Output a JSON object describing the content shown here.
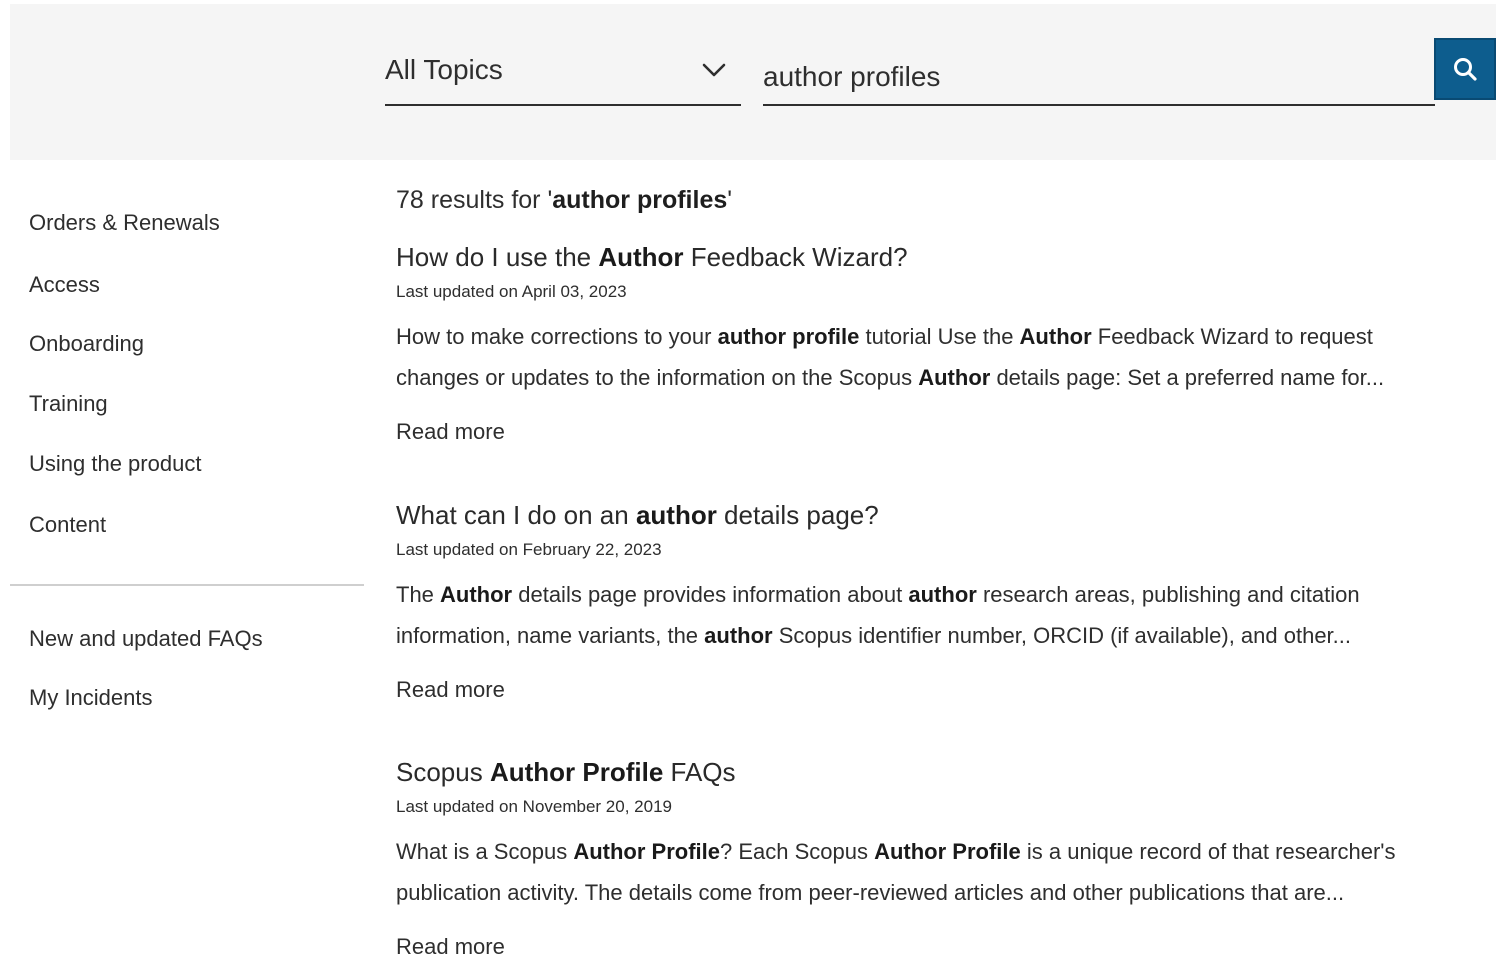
{
  "search": {
    "topic_selected": "All Topics",
    "query_value": "author profiles"
  },
  "sidebar": {
    "primary_items": [
      {
        "label": "Orders & Renewals"
      },
      {
        "label": "Access"
      },
      {
        "label": "Onboarding"
      },
      {
        "label": "Training"
      },
      {
        "label": "Using the product"
      },
      {
        "label": "Content"
      }
    ],
    "secondary_items": [
      {
        "label": "New and updated FAQs"
      },
      {
        "label": "My Incidents"
      }
    ]
  },
  "results": {
    "count": "78",
    "count_prefix": " results for '",
    "count_query": "author profiles",
    "count_suffix": "'",
    "read_more_label": "Read more",
    "items": [
      {
        "title": [
          {
            "t": "How do I use the ",
            "b": false
          },
          {
            "t": "Author",
            "b": true
          },
          {
            "t": " Feedback Wizard?",
            "b": false
          }
        ],
        "updated": "Last updated on April 03, 2023",
        "snippet_line1": [
          {
            "t": "How to make corrections to your ",
            "b": false
          },
          {
            "t": "author profile",
            "b": true
          },
          {
            "t": " tutorial  Use the ",
            "b": false
          },
          {
            "t": "Author",
            "b": true
          },
          {
            "t": " Feedback Wizard to request",
            "b": false
          }
        ],
        "snippet_line2": [
          {
            "t": "changes or updates to the information on the Scopus ",
            "b": false
          },
          {
            "t": "Author",
            "b": true
          },
          {
            "t": " details page: Set a preferred name for...",
            "b": false
          }
        ]
      },
      {
        "title": [
          {
            "t": "What can I do on an ",
            "b": false
          },
          {
            "t": "author",
            "b": true
          },
          {
            "t": " details page?",
            "b": false
          }
        ],
        "updated": "Last updated on February 22, 2023",
        "snippet_line1": [
          {
            "t": "The ",
            "b": false
          },
          {
            "t": "Author",
            "b": true
          },
          {
            "t": " details page provides information about ",
            "b": false
          },
          {
            "t": "author",
            "b": true
          },
          {
            "t": " research areas, publishing and citation",
            "b": false
          }
        ],
        "snippet_line2": [
          {
            "t": "information, name variants, the ",
            "b": false
          },
          {
            "t": "author",
            "b": true
          },
          {
            "t": " Scopus identifier number, ORCID (if available), and other...",
            "b": false
          }
        ]
      },
      {
        "title": [
          {
            "t": "Scopus ",
            "b": false
          },
          {
            "t": "Author Profile",
            "b": true
          },
          {
            "t": " FAQs",
            "b": false
          }
        ],
        "updated": "Last updated on November 20, 2019",
        "snippet_line1": [
          {
            "t": "What is a Scopus ",
            "b": false
          },
          {
            "t": "Author Profile",
            "b": true
          },
          {
            "t": "? Each Scopus ",
            "b": false
          },
          {
            "t": "Author Profile",
            "b": true
          },
          {
            "t": " is a unique record of that researcher's",
            "b": false
          }
        ],
        "snippet_line2": [
          {
            "t": "publication activity. The details come from peer-reviewed articles and other publications that are...",
            "b": false
          }
        ]
      }
    ]
  },
  "colors": {
    "search_band_bg": "#f5f5f5",
    "search_button_bg": "#0d5d8e",
    "text": "#2e2e2e",
    "divider": "#cfcfcf"
  },
  "icons": {
    "topic_dropdown": "chevron-down-icon",
    "search_button": "search-icon"
  }
}
